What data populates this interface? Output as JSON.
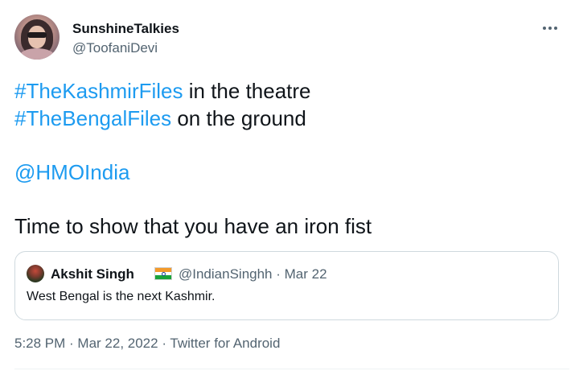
{
  "author": {
    "display_name": "SunshineTalkies",
    "handle": "@ToofaniDevi",
    "avatar_icon": "profile-photo"
  },
  "more_icon": "ellipsis-icon",
  "tweet": {
    "line1_tag": "#TheKashmirFiles",
    "line1_rest": " in the theatre",
    "line2_tag": "#TheBengalFiles",
    "line2_rest": " on the ground",
    "mention": "@HMOIndia",
    "line4": "Time to show that you have an iron fist"
  },
  "quoted_tweet": {
    "display_name": "Akshit Singh",
    "flag_emoji": "india-flag",
    "handle_date": "@IndianSinghh · Mar 22",
    "text": "West Bengal is the next Kashmir."
  },
  "meta": {
    "time_date": "5:28 PM · Mar 22, 2022 · ",
    "source": "Twitter for Android"
  },
  "colors": {
    "link": "#1d9bf0",
    "secondary_text": "#536471",
    "primary_text": "#0f1419",
    "border": "#cfd9de"
  }
}
